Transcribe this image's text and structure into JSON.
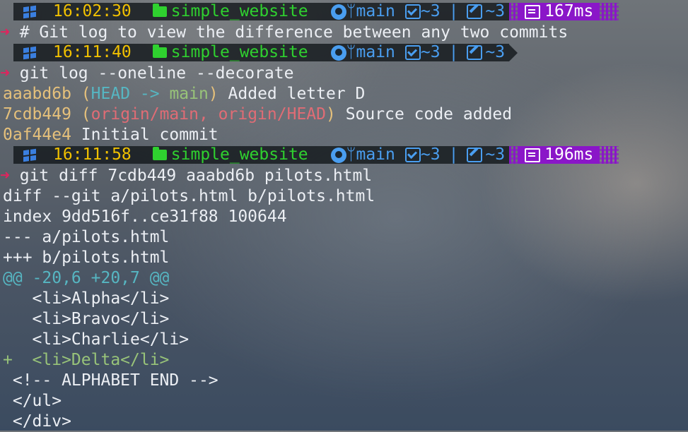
{
  "prompts": [
    {
      "time": "16:02:30",
      "repo": "simple_website",
      "branch": "main",
      "staged": "~3",
      "modified": "~3",
      "duration": "167ms"
    },
    {
      "time": "16:11:40",
      "repo": "simple_website",
      "branch": "main",
      "staged": "~3",
      "modified": "~3",
      "duration": ""
    },
    {
      "time": "16:11:58",
      "repo": "simple_website",
      "branch": "main",
      "staged": "~3",
      "modified": "~3",
      "duration": "196ms"
    }
  ],
  "arrow": "➜",
  "commands": [
    "# Git log to view the difference between any two commits",
    "git log --oneline --decorate",
    "git diff 7cdb449 aaabd6b pilots.html"
  ],
  "log": [
    {
      "hash": "aaabd6b",
      "open": "(",
      "ref1": "HEAD -> ",
      "ref2": "main",
      "close": ")",
      "msg": " Added letter D"
    },
    {
      "hash": "7cdb449",
      "open": "(",
      "ref1": "origin/main, ",
      "ref2": "origin/HEAD",
      "close": ")",
      "msg": " Source code added"
    },
    {
      "hash": "0af44e4",
      "msg": " Initial commit"
    }
  ],
  "diff": {
    "header1": "diff --git a/pilots.html b/pilots.html",
    "header2": "index 9dd516f..ce31f88 100644",
    "header3": "--- a/pilots.html",
    "header4": "+++ b/pilots.html",
    "hunk": "@@ -20,6 +20,7 @@",
    "ctx1": "   <li>Alpha</li>",
    "ctx2": "   <li>Bravo</li>",
    "ctx3": "   <li>Charlie</li>",
    "added_prefix": "+  ",
    "added": "<li>Delta</li>",
    "ctx4": " <!-- ALPHABET END -->",
    "ctx5": " </ul>",
    "ctx6": " </div>"
  }
}
